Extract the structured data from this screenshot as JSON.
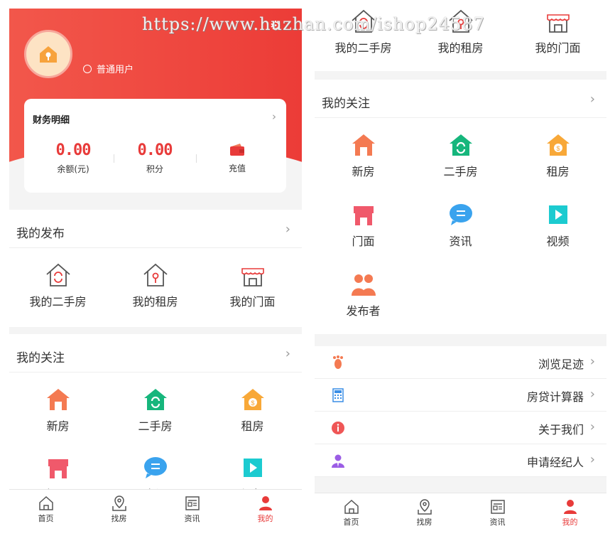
{
  "watermark": "https://www.huzhan.com/ishop24587",
  "colors": {
    "accent": "#e83b3a",
    "header_start": "#f2574b",
    "header_end": "#ec3c37"
  },
  "left": {
    "user": {
      "role": "普通用户"
    },
    "finance": {
      "title": "财务明细",
      "items": [
        {
          "value": "0.00",
          "label": "余额(元)"
        },
        {
          "value": "0.00",
          "label": "积分"
        },
        {
          "value": "",
          "label": "充值"
        }
      ]
    },
    "publish": {
      "title": "我的发布",
      "items": [
        {
          "label": "我的二手房"
        },
        {
          "label": "我的租房"
        },
        {
          "label": "我的门面"
        }
      ]
    },
    "follow": {
      "title": "我的关注",
      "items": [
        {
          "label": "新房"
        },
        {
          "label": "二手房"
        },
        {
          "label": "租房"
        },
        {
          "label": "门面"
        },
        {
          "label": "资讯"
        },
        {
          "label": "视频"
        }
      ]
    }
  },
  "right": {
    "publish_items": [
      {
        "label": "我的二手房"
      },
      {
        "label": "我的租房"
      },
      {
        "label": "我的门面"
      }
    ],
    "follow": {
      "title": "我的关注",
      "items": [
        {
          "label": "新房"
        },
        {
          "label": "二手房"
        },
        {
          "label": "租房"
        },
        {
          "label": "门面"
        },
        {
          "label": "资讯"
        },
        {
          "label": "视频"
        },
        {
          "label": "发布者"
        }
      ]
    },
    "list": [
      {
        "label": "浏览足迹",
        "icon": "footprint-icon"
      },
      {
        "label": "房贷计算器",
        "icon": "calculator-icon"
      },
      {
        "label": "关于我们",
        "icon": "info-icon"
      },
      {
        "label": "申请经纪人",
        "icon": "agent-icon"
      }
    ]
  },
  "tabbar": [
    {
      "label": "首页",
      "icon": "home-icon"
    },
    {
      "label": "找房",
      "icon": "map-pin-icon"
    },
    {
      "label": "资讯",
      "icon": "news-icon"
    },
    {
      "label": "我的",
      "icon": "user-icon"
    }
  ]
}
